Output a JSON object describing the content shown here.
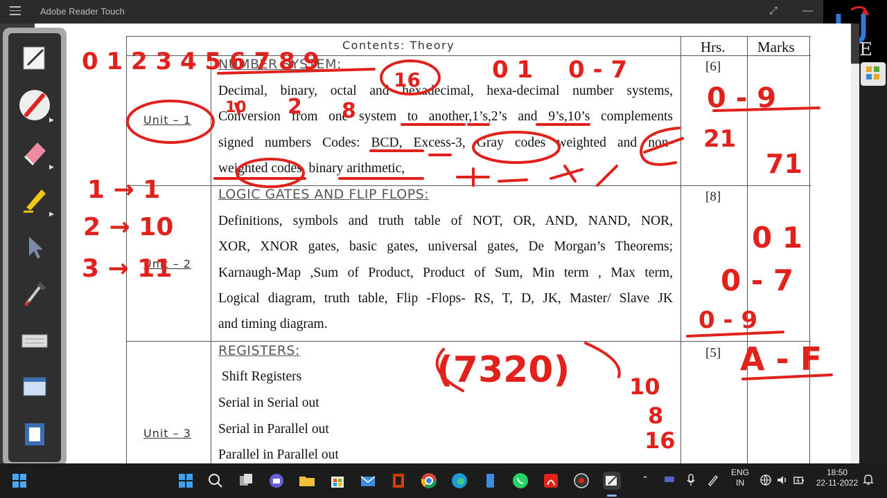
{
  "window": {
    "title": "Adobe Reader Touch"
  },
  "table": {
    "header": {
      "contents": "Contents: Theory",
      "hrs": "Hrs.",
      "marks": "Marks"
    },
    "units": [
      {
        "label": "Unit – 1",
        "section": "NUMBER SYSTEM:",
        "hours": "[6]",
        "lines": [
          "Decimal, binary, octal and hexadecimal, hexa-decimal number systems,",
          "Conversion from one system to another,1’s,2’s and 9’s,10’s complements",
          "signed numbers Codes: BCD, Excess-3, Gray codes weighted and non-",
          "weighted codes, binary arithmetic,"
        ]
      },
      {
        "label": "Unit – 2",
        "section": "LOGIC GATES AND FLIP FLOPS:",
        "hours": "[8]",
        "lines": [
          "Definitions, symbols and truth table of NOT, OR, AND, NAND, NOR,",
          "XOR,  XNOR gates, basic gates, universal gates, De Morgan’s Theorems;",
          "Karnaugh-Map ,Sum of Product, Product of Sum, Min term , Max term,",
          "Logical diagram, truth table, Flip -Flops- RS, T, D, JK, Master/ Slave JK",
          "and timing diagram."
        ]
      },
      {
        "label": "Unit – 3",
        "section": "REGISTERS:",
        "hours": "[5]",
        "lines": [
          " Shift Registers",
          "Serial in Serial out",
          "Serial in Parallel out",
          "Parallel in Parallel out"
        ]
      }
    ]
  },
  "annotations": {
    "top_left": "0 1 2 3 4 5 6 7 8 9",
    "sixteen": "16",
    "ten": "10",
    "two": "2",
    "eight": "8",
    "zero_one": "0 1",
    "zero_seven": "0 - 7",
    "zero_nine": "0 - 9",
    "twenty_one": "21",
    "seventy_one": "71",
    "map1": "1 → 1",
    "map2": "2 → 10",
    "map3": "3 → 11",
    "zero_one_b": "0 1",
    "zero_seven_b": "0 - 7",
    "zero_nine_b": "0 - 9",
    "a_f": "A - F",
    "number": "(7320)",
    "base10": "10",
    "base8": "8",
    "base16": "16"
  },
  "colors": {
    "ink": "#e0211c",
    "page": "#ffffff",
    "chrome": "#2b2b2b",
    "taskbar": "#1c1c1c"
  },
  "taskbar": {
    "lang1": "ENG",
    "lang2": "IN",
    "time": "18:50",
    "date": "22-11-2022",
    "apps": [
      "windows-icon",
      "search-icon",
      "taskview-icon",
      "chat-icon",
      "explorer-icon",
      "store-icon",
      "mail-icon",
      "office-icon",
      "chrome-icon",
      "edge-icon",
      "phone-icon",
      "whatsapp-icon",
      "acrobat-icon",
      "snip-icon",
      "reader-touch-icon"
    ]
  }
}
